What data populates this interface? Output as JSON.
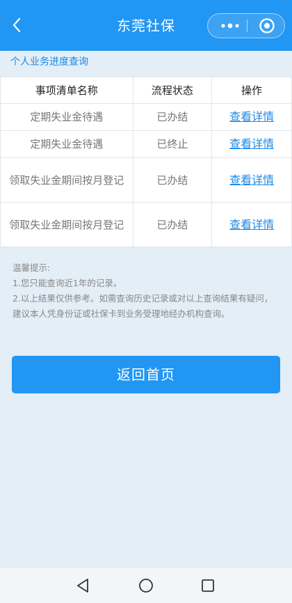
{
  "header": {
    "title": "东莞社保"
  },
  "section": {
    "title": "个人业务进度查询"
  },
  "table": {
    "columns": [
      "事项清单名称",
      "流程状态",
      "操作"
    ],
    "rows": [
      {
        "name": "定期失业金待遇",
        "status": "已办结",
        "action": "查看详情"
      },
      {
        "name": "定期失业金待遇",
        "status": "已终止",
        "action": "查看详情"
      },
      {
        "name": "领取失业金期间按月登记",
        "status": "已办结",
        "action": "查看详情"
      },
      {
        "name": "领取失业金期间按月登记",
        "status": "已办结",
        "action": "查看详情"
      }
    ]
  },
  "tips": {
    "heading": "温馨提示:",
    "line1": "1.您只能查询近1年的记录。",
    "line2": "2.以上结果仅供参考。如需查询历史记录或对以上查询结果有疑问，建议本人凭身份证或社保卡到业务受理地经办机构查询。"
  },
  "buttons": {
    "home": "返回首页"
  },
  "icons": {
    "back": "chevron-left-icon",
    "more": "more-dots-icon",
    "target": "target-circle-icon",
    "nav_back": "triangle-back-icon",
    "nav_home": "circle-home-icon",
    "nav_recent": "square-recent-icon"
  },
  "colors": {
    "primary": "#2196f3",
    "link": "#1e88e5",
    "background": "#e3eef7"
  }
}
